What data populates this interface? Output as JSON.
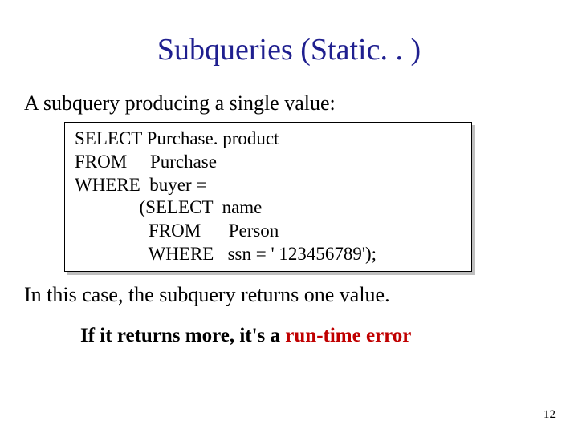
{
  "title": "Subqueries (Static. . )",
  "lead": "A subquery producing a single value:",
  "code": "SELECT Purchase. product\nFROM     Purchase\nWHERE  buyer =\n              (SELECT  name\n                FROM      Person\n                WHERE   ssn = ' 123456789');",
  "after": "In this case, the subquery returns one value.",
  "bold_prefix": "If it returns more, it's a ",
  "bold_error": "run-time error",
  "pagenum": "12"
}
